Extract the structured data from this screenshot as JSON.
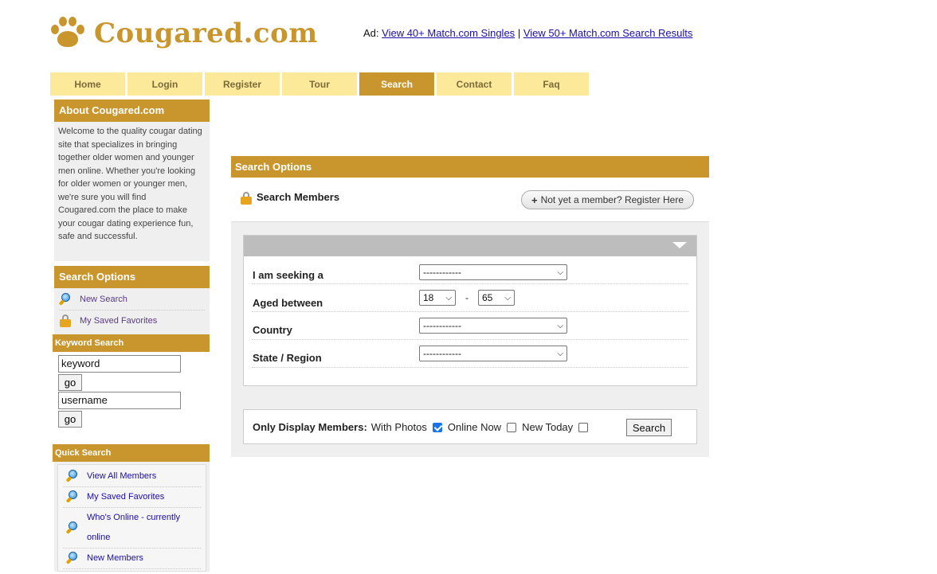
{
  "header": {
    "logo_text": "Cougared.com",
    "ad_prefix": "Ad:",
    "ad_link_1": "View 40+ Match.com Singles",
    "ad_separator": "|",
    "ad_link_2": "View 50+ Match.com Search Results"
  },
  "nav": {
    "items": [
      "Home",
      "Login",
      "Register",
      "Tour",
      "Search",
      "Contact",
      "Faq"
    ],
    "active": "Search"
  },
  "sidebar": {
    "about_title": "About Cougared.com",
    "about_text": "Welcome to the quality cougar dating site that specializes in bringing together older women and younger men online. Whether you're looking for older women or younger men, we're sure you will find Cougared.com the place to make your cougar dating experience fun, safe and successful.",
    "search_options_title": "Search Options",
    "search_options_items": [
      {
        "label": "New Search",
        "icon": "search-icon"
      },
      {
        "label": "My Saved Favorites",
        "icon": "lock-icon"
      }
    ],
    "keyword_title": "Keyword Search",
    "keyword_value": "keyword",
    "username_value": "username",
    "go_label": "go",
    "quick_title": "Quick Search",
    "quick_items": [
      {
        "label": "View All Members",
        "icon": "search-icon"
      },
      {
        "label": "My Saved Favorites",
        "icon": "search-icon"
      },
      {
        "label": "Who's Online - currently online",
        "icon": "search-icon"
      },
      {
        "label": "New Members",
        "icon": "search-icon"
      }
    ]
  },
  "main": {
    "header": "Search Options",
    "title": "Search Members",
    "register_button": "Not yet a member? Register Here",
    "fields": {
      "seeking_label": "I am seeking a",
      "seeking_value": "------------",
      "aged_label": "Aged between",
      "age_min": "18",
      "age_separator": "-",
      "age_max": "65",
      "country_label": "Country",
      "country_value": "------------",
      "state_label": "State / Region",
      "state_value": "------------"
    },
    "display": {
      "label": "Only Display Members:",
      "with_photos": "With Photos",
      "with_photos_checked": true,
      "online_now": "Online Now",
      "online_now_checked": false,
      "new_today": "New Today",
      "new_today_checked": false,
      "search_button": "Search"
    }
  },
  "colors": {
    "brand_gold": "#c9962e",
    "nav_light": "#fde99a",
    "panel_gray": "#efefef",
    "link_blue": "#1a0dab"
  }
}
